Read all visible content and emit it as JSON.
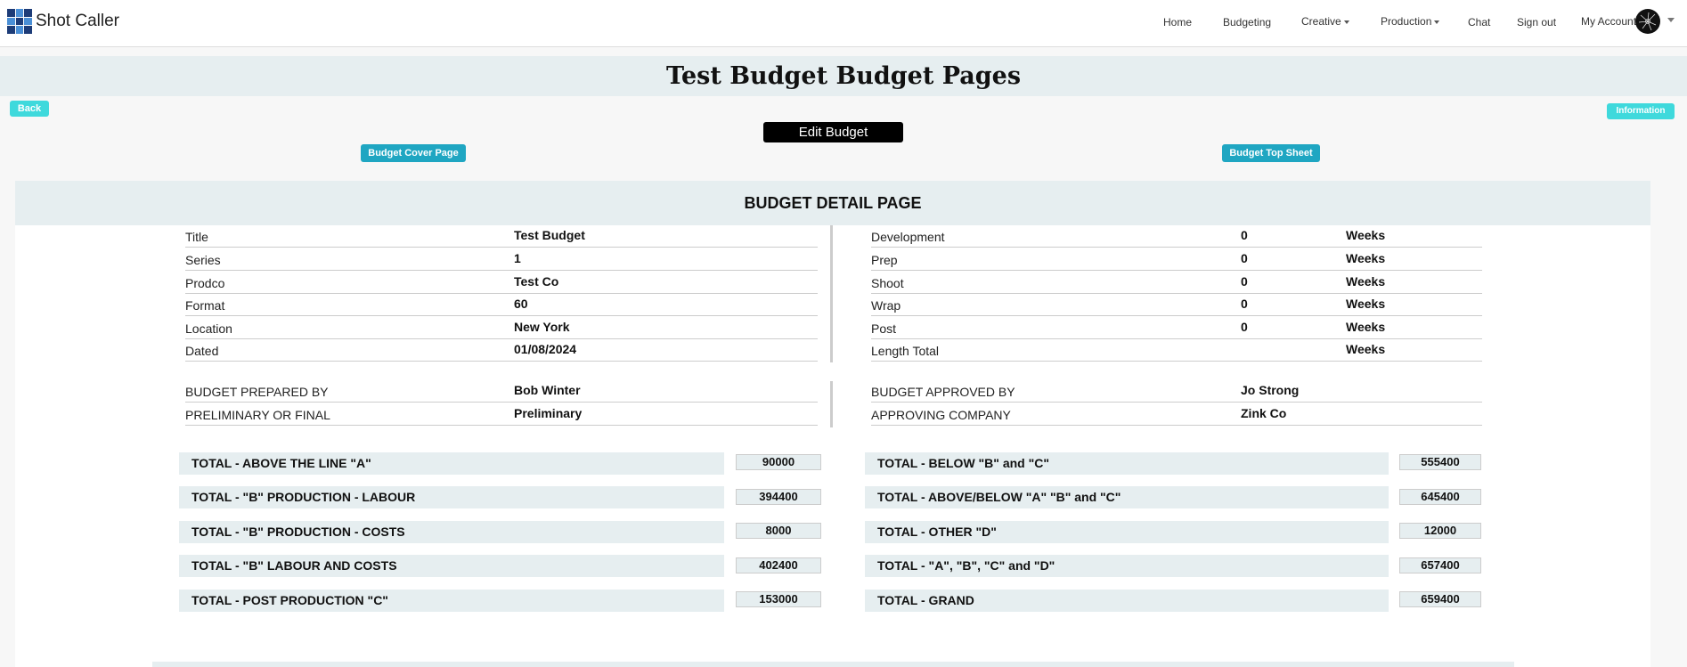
{
  "app": {
    "name": "Shot Caller"
  },
  "nav": {
    "home": "Home",
    "budgeting": "Budgeting",
    "creative": "Creative",
    "production": "Production",
    "chat": "Chat",
    "sign_out": "Sign out",
    "my_account": "My Account"
  },
  "page": {
    "title": "Test Budget Budget Pages",
    "back": "Back",
    "information": "Information",
    "edit_budget": "Edit Budget",
    "cover_page": "Budget Cover Page",
    "top_sheet": "Budget Top Sheet",
    "panel_title": "BUDGET DETAIL PAGE"
  },
  "details_left": [
    {
      "label": "Title",
      "value": "Test Budget"
    },
    {
      "label": "Series",
      "value": "1"
    },
    {
      "label": "Prodco",
      "value": "Test Co"
    },
    {
      "label": "Format",
      "value": "60"
    },
    {
      "label": "Location",
      "value": "New York"
    },
    {
      "label": "Dated",
      "value": "01/08/2024"
    }
  ],
  "details_right": [
    {
      "label": "Development",
      "value": "0",
      "unit": "Weeks"
    },
    {
      "label": "Prep",
      "value": "0",
      "unit": "Weeks"
    },
    {
      "label": "Shoot",
      "value": "0",
      "unit": "Weeks"
    },
    {
      "label": "Wrap",
      "value": "0",
      "unit": "Weeks"
    },
    {
      "label": "Post",
      "value": "0",
      "unit": "Weeks"
    },
    {
      "label": "Length Total",
      "value": "",
      "unit": "Weeks"
    }
  ],
  "prepared_left": [
    {
      "label": "BUDGET PREPARED BY",
      "value": "Bob Winter"
    },
    {
      "label": "PRELIMINARY OR FINAL",
      "value": "Preliminary"
    }
  ],
  "prepared_right": [
    {
      "label": "BUDGET APPROVED BY",
      "value": "Jo Strong"
    },
    {
      "label": "APPROVING COMPANY",
      "value": "Zink Co"
    }
  ],
  "totals_left": [
    {
      "label": "TOTAL - ABOVE THE LINE \"A\"",
      "value": "90000"
    },
    {
      "label": "TOTAL - \"B\" PRODUCTION - LABOUR",
      "value": "394400"
    },
    {
      "label": "TOTAL - \"B\" PRODUCTION - COSTS",
      "value": "8000"
    },
    {
      "label": "TOTAL - \"B\" LABOUR AND COSTS",
      "value": "402400"
    },
    {
      "label": "TOTAL - POST PRODUCTION \"C\"",
      "value": "153000"
    }
  ],
  "totals_right": [
    {
      "label": "TOTAL - BELOW \"B\" and \"C\"",
      "value": "555400"
    },
    {
      "label": "TOTAL - ABOVE/BELOW \"A\" \"B\" and \"C\"",
      "value": "645400"
    },
    {
      "label": "TOTAL - OTHER \"D\"",
      "value": "12000"
    },
    {
      "label": "TOTAL - \"A\", \"B\", \"C\" and \"D\"",
      "value": "657400"
    },
    {
      "label": "TOTAL - GRAND",
      "value": "659400"
    }
  ],
  "colors": {
    "band": "#e6eef0",
    "cyan_button": "#3fd9dc",
    "teal_button": "#1fa6c2"
  }
}
